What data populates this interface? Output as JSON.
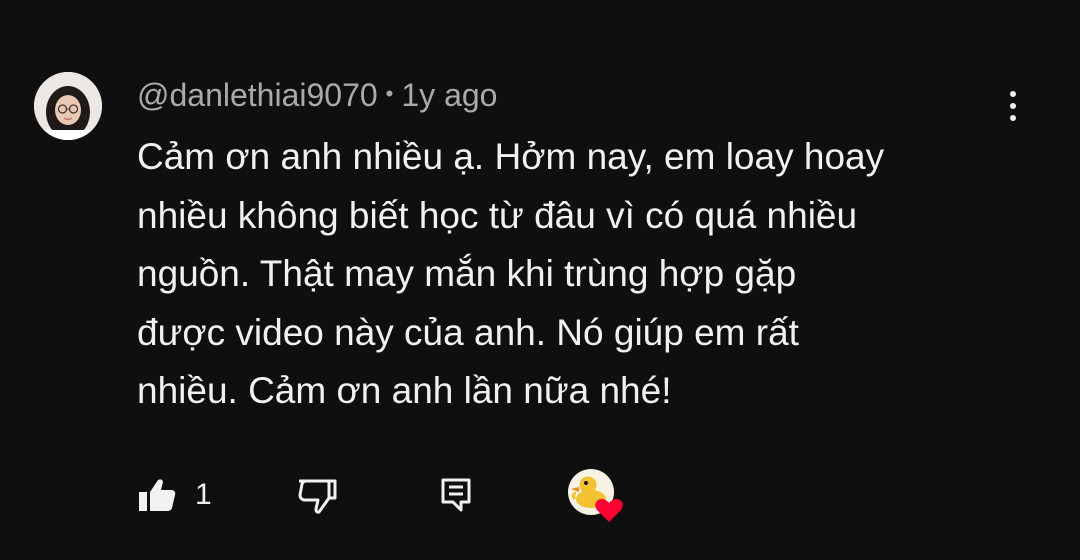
{
  "comment": {
    "author": "@danlethiai9070",
    "separator": "•",
    "time": "1y ago",
    "lines": [
      "Cảm ơn anh nhiều ạ. Hởm nay, em loay hoay",
      "nhiều không biết học từ đâu vì có quá nhiều",
      "nguồn. Thật may mắn khi trùng hợp gặp",
      "được video này của anh. Nó giúp em rất",
      "nhiều. Cảm ơn anh lần nữa nhé!"
    ],
    "like_count": "1"
  },
  "icons": {
    "more": "more-vert-icon",
    "like": "thumbs-up-icon",
    "dislike": "thumbs-down-icon",
    "reply": "reply-comment-icon",
    "heart": "creator-heart-icon"
  },
  "colors": {
    "background": "#0f0f0f",
    "text_primary": "#f1f1f1",
    "text_secondary": "#aaaaaa",
    "heart": "#ff0033"
  }
}
